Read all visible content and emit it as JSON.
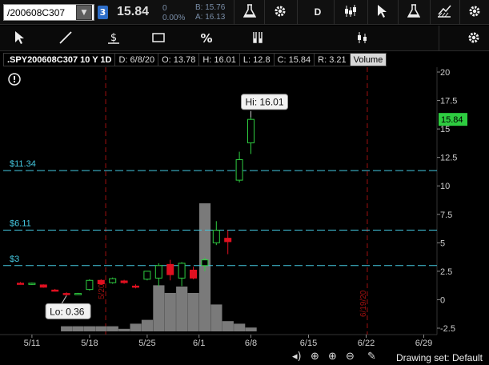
{
  "topbar": {
    "symbol": "/200608C307",
    "badge": "3",
    "last": "15.84",
    "change": "0",
    "change_pct": "0.00%",
    "bid": "B: 15.76",
    "ask": "A: 16.13",
    "period_button": "D"
  },
  "header": {
    "symbol": ".SPY200608C307 10 Y 1D",
    "date": "D: 6/8/20",
    "open": "O: 13.78",
    "high": "H: 16.01",
    "low": "L: 12.8",
    "close": "C: 15.84",
    "range": "R: 3.21",
    "study": "Volume"
  },
  "status": {
    "drawing_set": "Drawing set: Default"
  },
  "colors": {
    "up": "#2ecc40",
    "down": "#e01020",
    "price_line": "#44c8e0",
    "volume": "#7a7a7a",
    "last_tag": "#2ecc40"
  },
  "chart_data": {
    "type": "candlestick",
    "ylim": [
      -2.5,
      20
    ],
    "yticks": [
      -2.5,
      0,
      2.5,
      5,
      7.5,
      10,
      12.5,
      15,
      17.5,
      20
    ],
    "xticks": [
      "5/11",
      "5/18",
      "5/25",
      "6/1",
      "6/8",
      "6/15",
      "6/22",
      "6/29"
    ],
    "last_price": "15.84",
    "price_levels": [
      {
        "label": "$11.34",
        "value": 11.34
      },
      {
        "label": "$6.11",
        "value": 6.11
      },
      {
        "label": "$3",
        "value": 3
      }
    ],
    "annotations": {
      "high": "Hi: 16.01",
      "low": "Lo: 0.36",
      "left_marker": "5/20",
      "right_marker": "6/19/20"
    },
    "candles": [
      {
        "date": "5/8",
        "o": 1.45,
        "h": 1.55,
        "l": 1.35,
        "c": 1.4
      },
      {
        "date": "5/11",
        "o": 1.35,
        "h": 1.5,
        "l": 1.3,
        "c": 1.45
      },
      {
        "date": "5/12",
        "o": 1.3,
        "h": 1.35,
        "l": 1.05,
        "c": 1.1
      },
      {
        "date": "5/13",
        "o": 0.85,
        "h": 0.95,
        "l": 0.75,
        "c": 0.8
      },
      {
        "date": "5/14",
        "o": 0.55,
        "h": 0.65,
        "l": 0.36,
        "c": 0.45
      },
      {
        "date": "5/15",
        "o": 0.5,
        "h": 0.6,
        "l": 0.45,
        "c": 0.55
      },
      {
        "date": "5/18",
        "o": 0.9,
        "h": 1.8,
        "l": 0.8,
        "c": 1.7
      },
      {
        "date": "5/19",
        "o": 1.7,
        "h": 1.8,
        "l": 1.3,
        "c": 1.4
      },
      {
        "date": "5/20",
        "o": 1.5,
        "h": 1.95,
        "l": 1.4,
        "c": 1.85
      },
      {
        "date": "5/21",
        "o": 1.65,
        "h": 1.75,
        "l": 1.4,
        "c": 1.5
      },
      {
        "date": "5/22",
        "o": 1.2,
        "h": 1.35,
        "l": 1.0,
        "c": 1.1
      },
      {
        "date": "5/26",
        "o": 1.8,
        "h": 2.5,
        "l": 1.7,
        "c": 2.5
      },
      {
        "date": "5/27",
        "o": 1.9,
        "h": 3.2,
        "l": 1.2,
        "c": 3.0
      },
      {
        "date": "5/28",
        "o": 3.1,
        "h": 3.5,
        "l": 1.7,
        "c": 2.2
      },
      {
        "date": "5/29",
        "o": 1.9,
        "h": 3.3,
        "l": 1.2,
        "c": 3.2
      },
      {
        "date": "6/1",
        "o": 2.6,
        "h": 2.9,
        "l": 1.8,
        "c": 1.9
      },
      {
        "date": "6/2",
        "o": 3.0,
        "h": 3.7,
        "l": 2.5,
        "c": 3.5
      },
      {
        "date": "6/3",
        "o": 5.0,
        "h": 6.9,
        "l": 4.8,
        "c": 6.1
      },
      {
        "date": "6/4",
        "o": 5.4,
        "h": 6.1,
        "l": 4.0,
        "c": 5.1
      },
      {
        "date": "6/5",
        "o": 10.5,
        "h": 13.0,
        "l": 10.3,
        "c": 12.3
      },
      {
        "date": "6/8",
        "o": 13.78,
        "h": 16.01,
        "l": 12.8,
        "c": 15.84
      }
    ],
    "volume": [
      0,
      0,
      0,
      0,
      0.04,
      0.04,
      0.04,
      0.04,
      0.04,
      0.02,
      0.06,
      0.09,
      0.36,
      0.3,
      0.35,
      0.3,
      1.0,
      0.21,
      0.08,
      0.06,
      0.03
    ]
  }
}
